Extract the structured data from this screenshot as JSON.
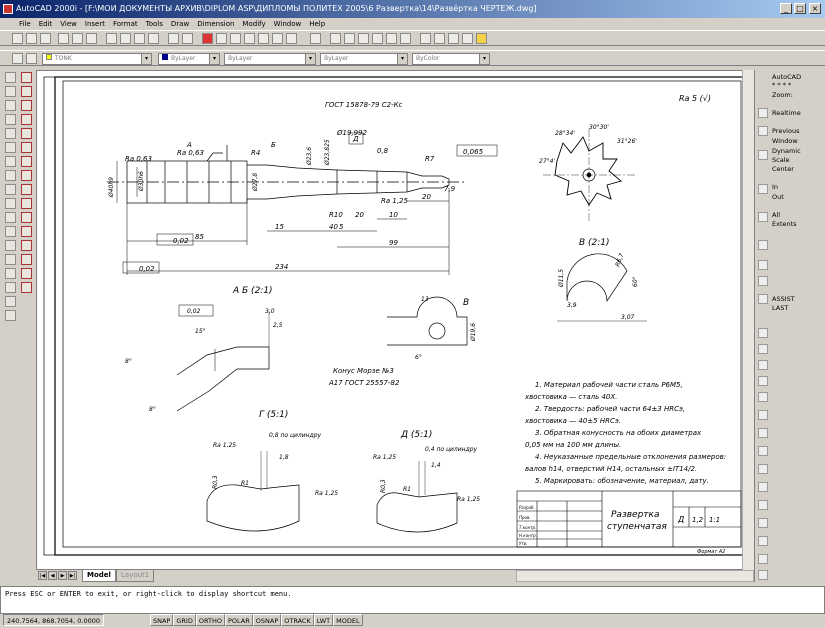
{
  "window": {
    "title": "AutoCAD 2000i - [F:\\МОИ ДОКУМЕНТЫ АРХИВ\\DIPLOM ASP\\ДИПЛОМЫ ПОЛИТЕХ 2005\\6 Развертка\\14\\Развёртка ЧЕРТЕЖ.dwg]",
    "min": "_",
    "max": "□",
    "close": "×"
  },
  "menu": [
    "File",
    "Edit",
    "View",
    "Insert",
    "Format",
    "Tools",
    "Draw",
    "Dimension",
    "Modify",
    "Window",
    "Help"
  ],
  "properties": {
    "layer": "TONK",
    "color": "ByLayer",
    "linetype": "ByLayer",
    "lineweight": "ByLayer",
    "plotstyle": "ByColor"
  },
  "zoom_panel": {
    "header": "AutoCAD",
    "stars": "* * * *",
    "zoom": "Zoom:",
    "realtime": "Realtime",
    "previous": "Previous",
    "window": "Window",
    "dynamic": "Dynamic",
    "scale": "Scale",
    "center": "Center",
    "in": "In",
    "out": "Out",
    "all": "All",
    "extents": "Extents",
    "assist": "ASSIST",
    "last": "LAST"
  },
  "tabs": {
    "model": "Model",
    "layout": "Layout1"
  },
  "command_line": "Press ESC or ENTER to exit, or right-click to display shortcut menu.",
  "status": {
    "coords": "240.7564, 868.7054, 0.0000",
    "modes": [
      "SNAP",
      "GRID",
      "ORTHO",
      "POLAR",
      "OSNAP",
      "OTRACK",
      "LWT",
      "MODEL"
    ]
  },
  "drawing": {
    "roughness": "Ra 5 (√)",
    "gost_center": "ГОСТ 15878-79 С2-Кс",
    "labels": {
      "a": "А",
      "b": "Б",
      "v": "В",
      "d": "Д",
      "r4": "R4",
      "r7": "R7",
      "r10": "R10",
      "d23_825": "Ø23,825",
      "d19_992": "Ø19,992",
      "d23_6": "Ø23,6",
      "d40h9": "Ø40h9",
      "d27_8": "Ø27,8",
      "d30h6": "Ø30h6",
      "tol_065": "0,065",
      "tol_02a": "0,02",
      "tol_02b": "0,02",
      "ra063": "Ra 0,63",
      "ra125": "Ra 1,25",
      "ra16": "Ra 0,63",
      "d8": "0,8",
      "d79": "7,9"
    },
    "dims": {
      "d85": "85",
      "d234": "234",
      "d99": "99",
      "d40": "40",
      "d15": "15",
      "d10": "10",
      "d20a": "20",
      "d20b": "20",
      "d5": "5"
    },
    "section_ab": "А Б (2:1)",
    "ab_vals": {
      "v30": "3,0",
      "v25": "2,5",
      "v15": "15°",
      "v8a": "8°",
      "v8b": "8°",
      "tol": "0,02"
    },
    "section_v": "В",
    "v_vals": {
      "v13": "13",
      "d196": "Ø19,6",
      "a6": "6°"
    },
    "cone_note_1": "Конус Морзе №3",
    "cone_note_2": "А17 ГОСТ 25557-82",
    "view_b21": "В (2:1)",
    "b21_vals": {
      "d115": "Ø11,5",
      "r67": "R6,7",
      "v60": "60°",
      "v39": "3,9",
      "v307": "3,07"
    },
    "gear_vals": {
      "a1": "27°4'",
      "a2": "28°34'",
      "a3": "30°30'",
      "a4": "31°26'"
    },
    "notes": [
      "1. Материал рабочей части сталь Р6М5,",
      "хвостовика — сталь 40Х.",
      "2. Твердость: рабочей части 64±3 HRCэ,",
      "хвостовика — 40±5 HRCэ.",
      "3. Обратная конусность на обоих диаметрах",
      "0,05 мм на 100 мм длины.",
      "4. Неуказанные предельные отклонения размеров:",
      "валов h14, отверстий H14, остальных ±IT14/2.",
      "5. Маркировать: обозначение, материал, дату."
    ],
    "view_g": "Г (5:1)",
    "g_vals": {
      "tol": "0,8 по цилиндру",
      "v18": "1,8",
      "ra": "Ra 1,25",
      "r1": "R1",
      "r03": "R0,3",
      "ra2": "Ra 1,25"
    },
    "view_d": "Д (5:1)",
    "d_vals": {
      "tol": "0,4 по цилиндру",
      "v14": "1,4",
      "ra": "Ra 1,25",
      "r1": "R1",
      "r03": "R0,3",
      "ra2": "Ra 1,25"
    },
    "title_block": {
      "name_1": "Развертка",
      "name_2": "ступенчатая",
      "lit": "Д",
      "mass": "1,2",
      "scale": "1:1",
      "format": "Формат А2",
      "rows": [
        "Разраб.",
        "Пров.",
        "Т.контр.",
        "Н.контр.",
        "Утв."
      ]
    }
  }
}
